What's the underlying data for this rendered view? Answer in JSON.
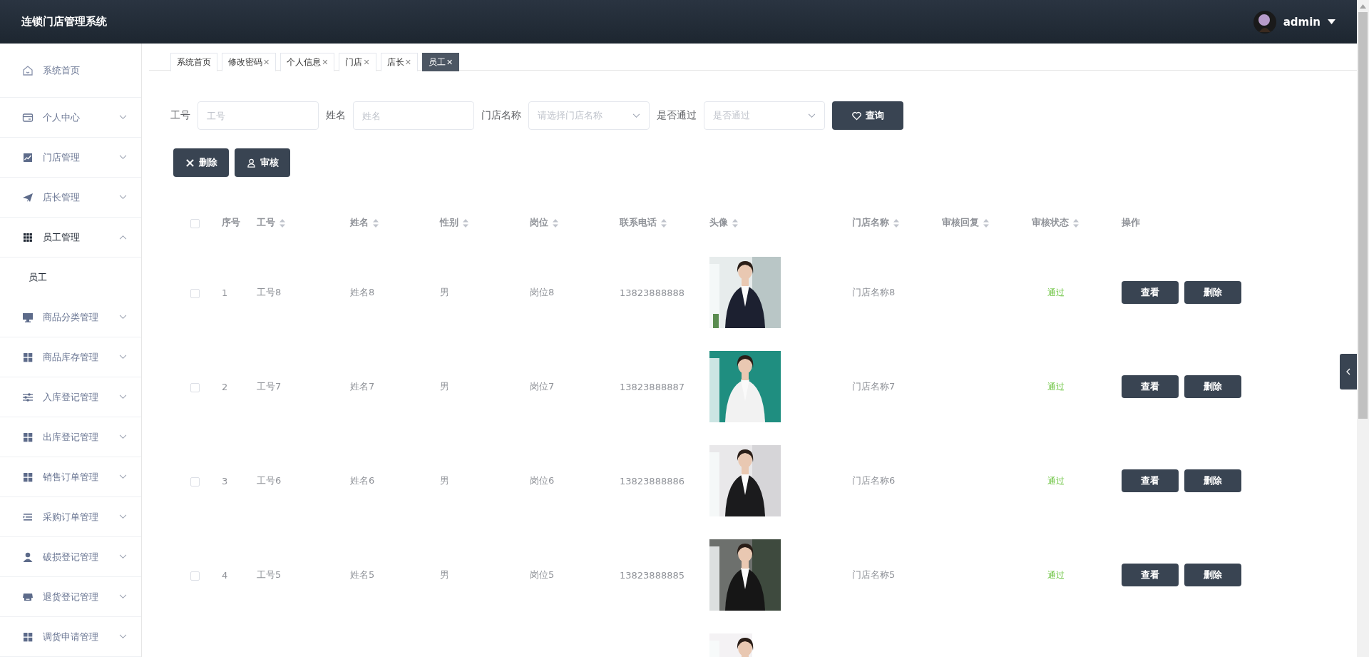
{
  "header": {
    "title": "连锁门店管理系统",
    "user": "admin"
  },
  "sidebar": {
    "items": [
      {
        "label": "系统首页"
      },
      {
        "label": "个人中心",
        "expanded": false
      },
      {
        "label": "门店管理",
        "expanded": false
      },
      {
        "label": "店长管理",
        "expanded": false
      },
      {
        "label": "员工管理",
        "expanded": true,
        "children": [
          {
            "label": "员工",
            "selected": true
          }
        ]
      },
      {
        "label": "商品分类管理",
        "expanded": false
      },
      {
        "label": "商品库存管理",
        "expanded": false
      },
      {
        "label": "入库登记管理",
        "expanded": false
      },
      {
        "label": "出库登记管理",
        "expanded": false
      },
      {
        "label": "销售订单管理",
        "expanded": false
      },
      {
        "label": "采购订单管理",
        "expanded": false
      },
      {
        "label": "破损登记管理",
        "expanded": false
      },
      {
        "label": "退货登记管理",
        "expanded": false
      },
      {
        "label": "调货申请管理",
        "expanded": false
      }
    ]
  },
  "tabs": [
    {
      "label": "系统首页",
      "selected": false
    },
    {
      "label": "修改密码",
      "close": "✕",
      "selected": false
    },
    {
      "label": "个人信息",
      "close": "✕",
      "selected": false
    },
    {
      "label": "门店",
      "close": "✕",
      "selected": false
    },
    {
      "label": "店长",
      "close": "✕",
      "selected": false
    },
    {
      "label": "员工",
      "close": "✕",
      "selected": true
    }
  ],
  "filters": [
    {
      "kind": "input",
      "label": "工号",
      "placeholder": "工号"
    },
    {
      "kind": "input",
      "label": "姓名",
      "placeholder": "姓名"
    },
    {
      "kind": "select",
      "label": "门店名称",
      "placeholder": "请选择门店名称"
    },
    {
      "kind": "select",
      "label": "是否通过",
      "placeholder": "是否通过"
    }
  ],
  "search_button": "查询",
  "actions": [
    {
      "kind": "delete",
      "label": "删除"
    },
    {
      "kind": "audit",
      "label": "审核"
    }
  ],
  "table": {
    "select_all": {
      "checked": false
    },
    "columns": [
      {
        "label": "序号",
        "kind": "plain"
      },
      {
        "label": "工号",
        "kind": "sortable"
      },
      {
        "label": "姓名",
        "kind": "sortable"
      },
      {
        "label": "性别",
        "kind": "sortable"
      },
      {
        "label": "岗位",
        "kind": "sortable"
      },
      {
        "label": "联系电话",
        "kind": "sortable"
      },
      {
        "label": "头像",
        "kind": "sortable"
      },
      {
        "label": "门店名称",
        "kind": "sortable"
      },
      {
        "label": "审核回复",
        "kind": "sortable"
      },
      {
        "label": "审核状态",
        "kind": "sortable"
      },
      {
        "label": "操作",
        "kind": "plain"
      }
    ],
    "rows": [
      {
        "checked": false,
        "index": "1",
        "id": "工号8",
        "name": "姓名8",
        "gender": "男",
        "post": "岗位8",
        "phone": "13823888888",
        "photo": {
          "kind": "picture"
        },
        "store": "门店名称8",
        "status": "通过",
        "buttons": [
          "查看",
          "删除"
        ]
      },
      {
        "checked": false,
        "index": "2",
        "id": "工号7",
        "name": "姓名7",
        "gender": "男",
        "post": "岗位7",
        "phone": "13823888887",
        "photo": {
          "kind": "picture"
        },
        "store": "门店名称7",
        "status": "通过",
        "buttons": [
          "查看",
          "删除"
        ]
      },
      {
        "checked": false,
        "index": "3",
        "id": "工号6",
        "name": "姓名6",
        "gender": "男",
        "post": "岗位6",
        "phone": "13823888886",
        "photo": {
          "kind": "picture"
        },
        "store": "门店名称6",
        "status": "通过",
        "buttons": [
          "查看",
          "删除"
        ]
      },
      {
        "checked": false,
        "index": "4",
        "id": "工号5",
        "name": "姓名5",
        "gender": "男",
        "post": "岗位5",
        "phone": "13823888885",
        "photo": {
          "kind": "picture"
        },
        "store": "门店名称5",
        "status": "通过",
        "buttons": [
          "查看",
          "删除"
        ]
      },
      {
        "photo": {
          "kind": "picture"
        }
      }
    ]
  }
}
